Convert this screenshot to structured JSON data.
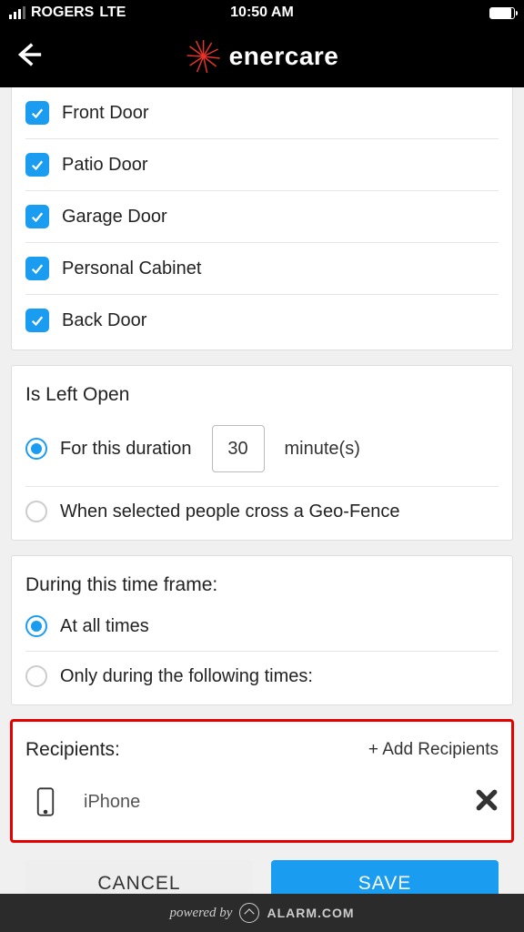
{
  "status": {
    "carrier": "ROGERS",
    "network": "LTE",
    "time": "10:50 AM"
  },
  "brand": "enercare",
  "checklist": [
    {
      "label": "Front Door",
      "checked": true
    },
    {
      "label": "Patio Door",
      "checked": true
    },
    {
      "label": "Garage Door",
      "checked": true
    },
    {
      "label": "Personal Cabinet",
      "checked": true
    },
    {
      "label": "Back Door",
      "checked": true
    }
  ],
  "leftOpen": {
    "title": "Is Left Open",
    "options": [
      {
        "label": "For this duration",
        "selected": true
      },
      {
        "label": "When selected people cross a Geo-Fence",
        "selected": false
      }
    ],
    "duration_value": "30",
    "duration_unit": "minute(s)"
  },
  "timeFrame": {
    "title": "During this time frame:",
    "options": [
      {
        "label": "At all times",
        "selected": true
      },
      {
        "label": "Only during the following times:",
        "selected": false
      }
    ]
  },
  "recipients": {
    "title": "Recipients:",
    "add_label": "+ Add Recipients",
    "items": [
      {
        "label": "iPhone"
      }
    ]
  },
  "buttons": {
    "cancel": "CANCEL",
    "save": "SAVE"
  },
  "footer": {
    "powered": "powered by",
    "brand": "ALARM.COM"
  }
}
